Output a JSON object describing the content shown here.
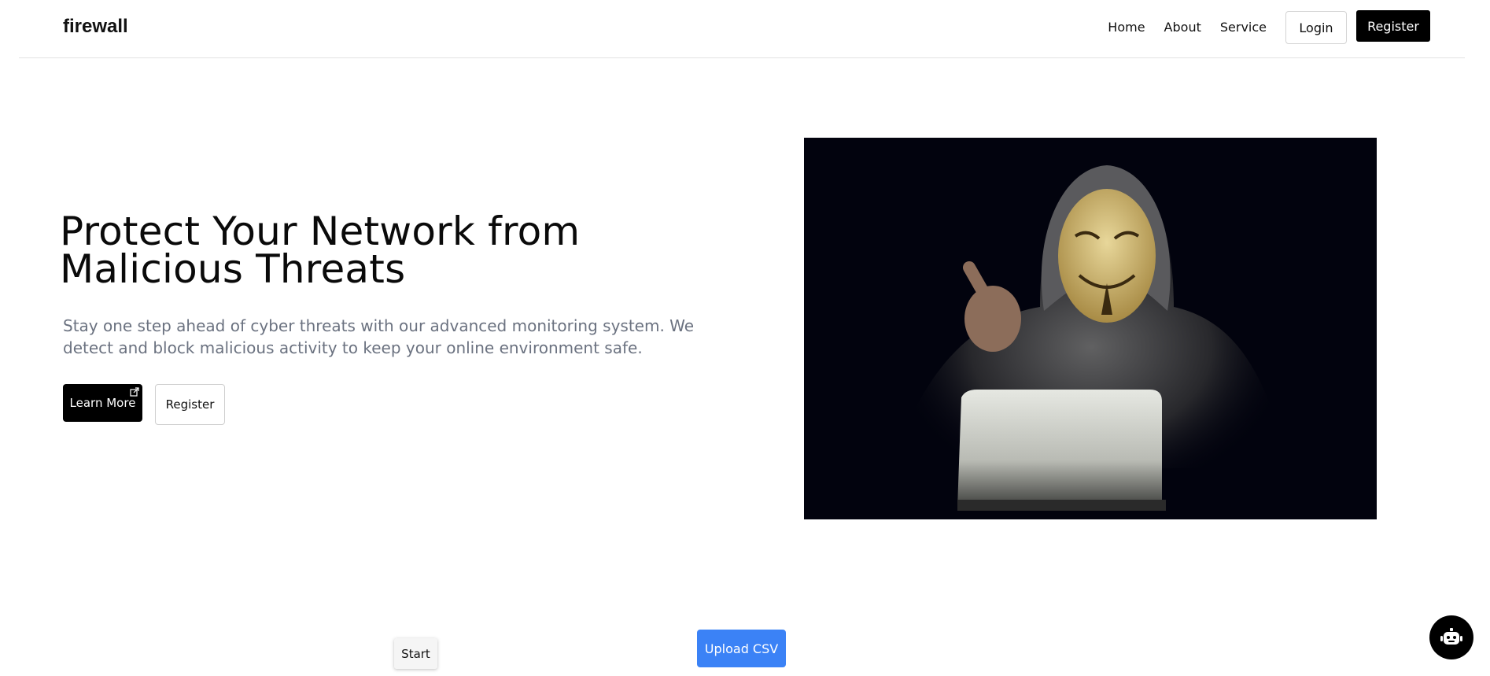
{
  "header": {
    "brand": "firewall",
    "nav": {
      "home": "Home",
      "about": "About",
      "service": "Service"
    },
    "login_label": "Login",
    "register_label": "Register"
  },
  "hero": {
    "title": "Protect Your Network from Malicious Threats",
    "description": "Stay one step ahead of cyber threats with our advanced monitoring system. We detect and block malicious activity to keep your online environment safe.",
    "learn_more_label": "Learn More",
    "register_label": "Register",
    "image_icon": "hooded-hacker-laptop-image"
  },
  "controls": {
    "start_label": "Start",
    "upload_label": "Upload CSV",
    "chatbot_icon": "robot-icon"
  },
  "colors": {
    "primary_dark": "#000000",
    "upload_blue": "#3b82f6",
    "muted_text": "#6b7280",
    "image_bg": "#02030e"
  }
}
